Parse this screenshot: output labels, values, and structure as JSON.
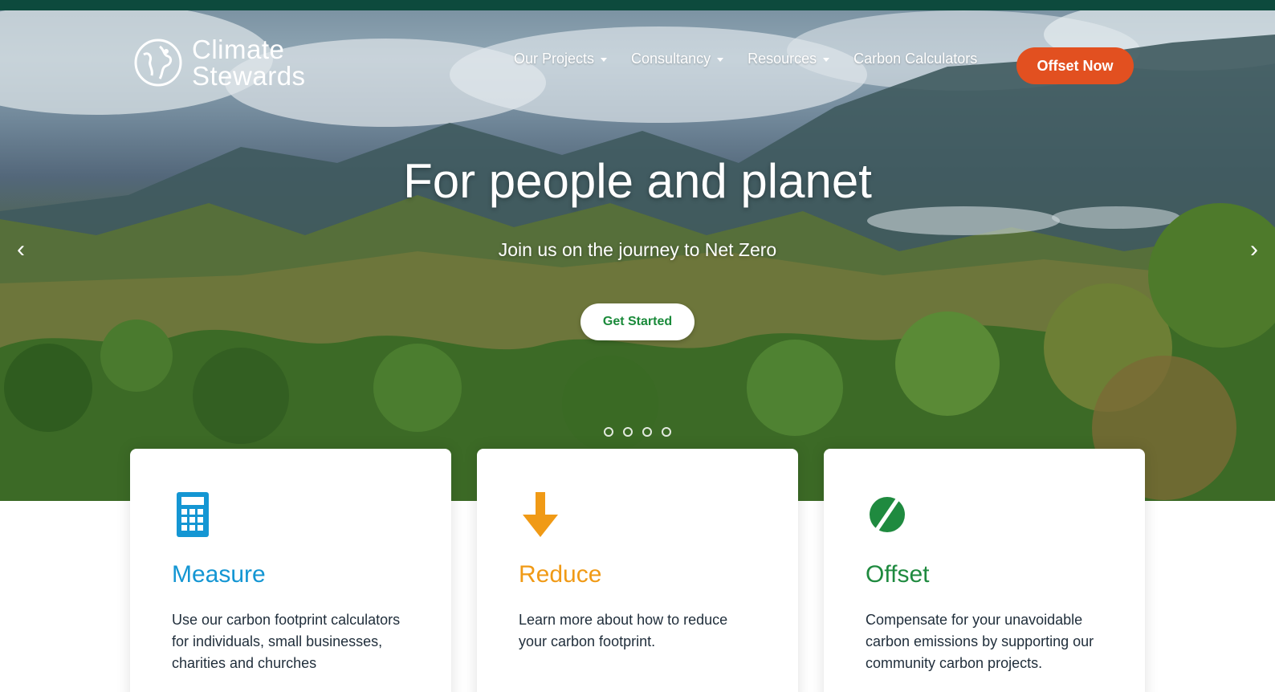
{
  "colors": {
    "topbar": "#0d4a3d",
    "offset_button": "#e25020",
    "cta_text": "#1a8a3a",
    "measure": "#1496d3",
    "reduce": "#f09a16",
    "offset": "#1f8a3f"
  },
  "brand": {
    "line1": "Climate",
    "line2": "Stewards",
    "icon": "globe-icon"
  },
  "nav": {
    "items": [
      {
        "label": "Our Projects",
        "dropdown": true
      },
      {
        "label": "Consultancy",
        "dropdown": true
      },
      {
        "label": "Resources",
        "dropdown": true
      },
      {
        "label": "Carbon Calculators",
        "dropdown": false
      }
    ],
    "cta_label": "Offset Now"
  },
  "hero": {
    "title": "For people and planet",
    "subtitle": "Join us on the journey to Net Zero",
    "button_label": "Get Started",
    "prev_icon": "chevron-left-icon",
    "next_icon": "chevron-right-icon",
    "slide_count": 4
  },
  "cards": [
    {
      "title": "Measure",
      "icon": "calculator-icon",
      "description": "Use our carbon footprint calculators for individuals, small businesses, charities and churches"
    },
    {
      "title": "Reduce",
      "icon": "arrow-down-icon",
      "description": "Learn more about how to reduce your carbon footprint."
    },
    {
      "title": "Offset",
      "icon": "offset-leaf-icon",
      "description": "Compensate for your unavoidable carbon emissions by supporting our community carbon projects."
    }
  ]
}
